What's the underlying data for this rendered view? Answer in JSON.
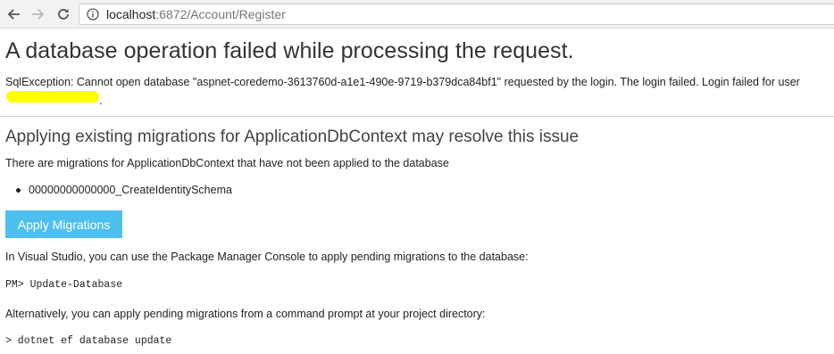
{
  "browser": {
    "url_host": "localhost",
    "url_path": ":6872/Account/Register",
    "icons": {
      "back": "back-arrow-icon",
      "forward": "forward-arrow-icon",
      "reload": "reload-icon",
      "info": "info-icon"
    }
  },
  "page": {
    "title": "A database operation failed while processing the request.",
    "error_message": "SqlException: Cannot open database \"aspnet-coredemo-3613760d-a1e1-490e-9719-b379dca84bf1\" requested by the login. The login failed. Login failed for user",
    "error_message_end": ".",
    "redaction_color": "#ffff00",
    "migrations_heading": "Applying existing migrations for ApplicationDbContext may resolve this issue",
    "migrations_intro": "There are migrations for ApplicationDbContext that have not been applied to the database",
    "migrations": [
      "00000000000000_CreateIdentitySchema"
    ],
    "apply_button_label": "Apply Migrations",
    "apply_button_color": "#4ec0ef",
    "vs_instruction": "In Visual Studio, you can use the Package Manager Console to apply pending migrations to the database:",
    "pm_command": "PM> Update-Database",
    "cli_instruction": "Alternatively, you can apply pending migrations from a command prompt at your project directory:",
    "cli_command": "> dotnet ef database update"
  }
}
